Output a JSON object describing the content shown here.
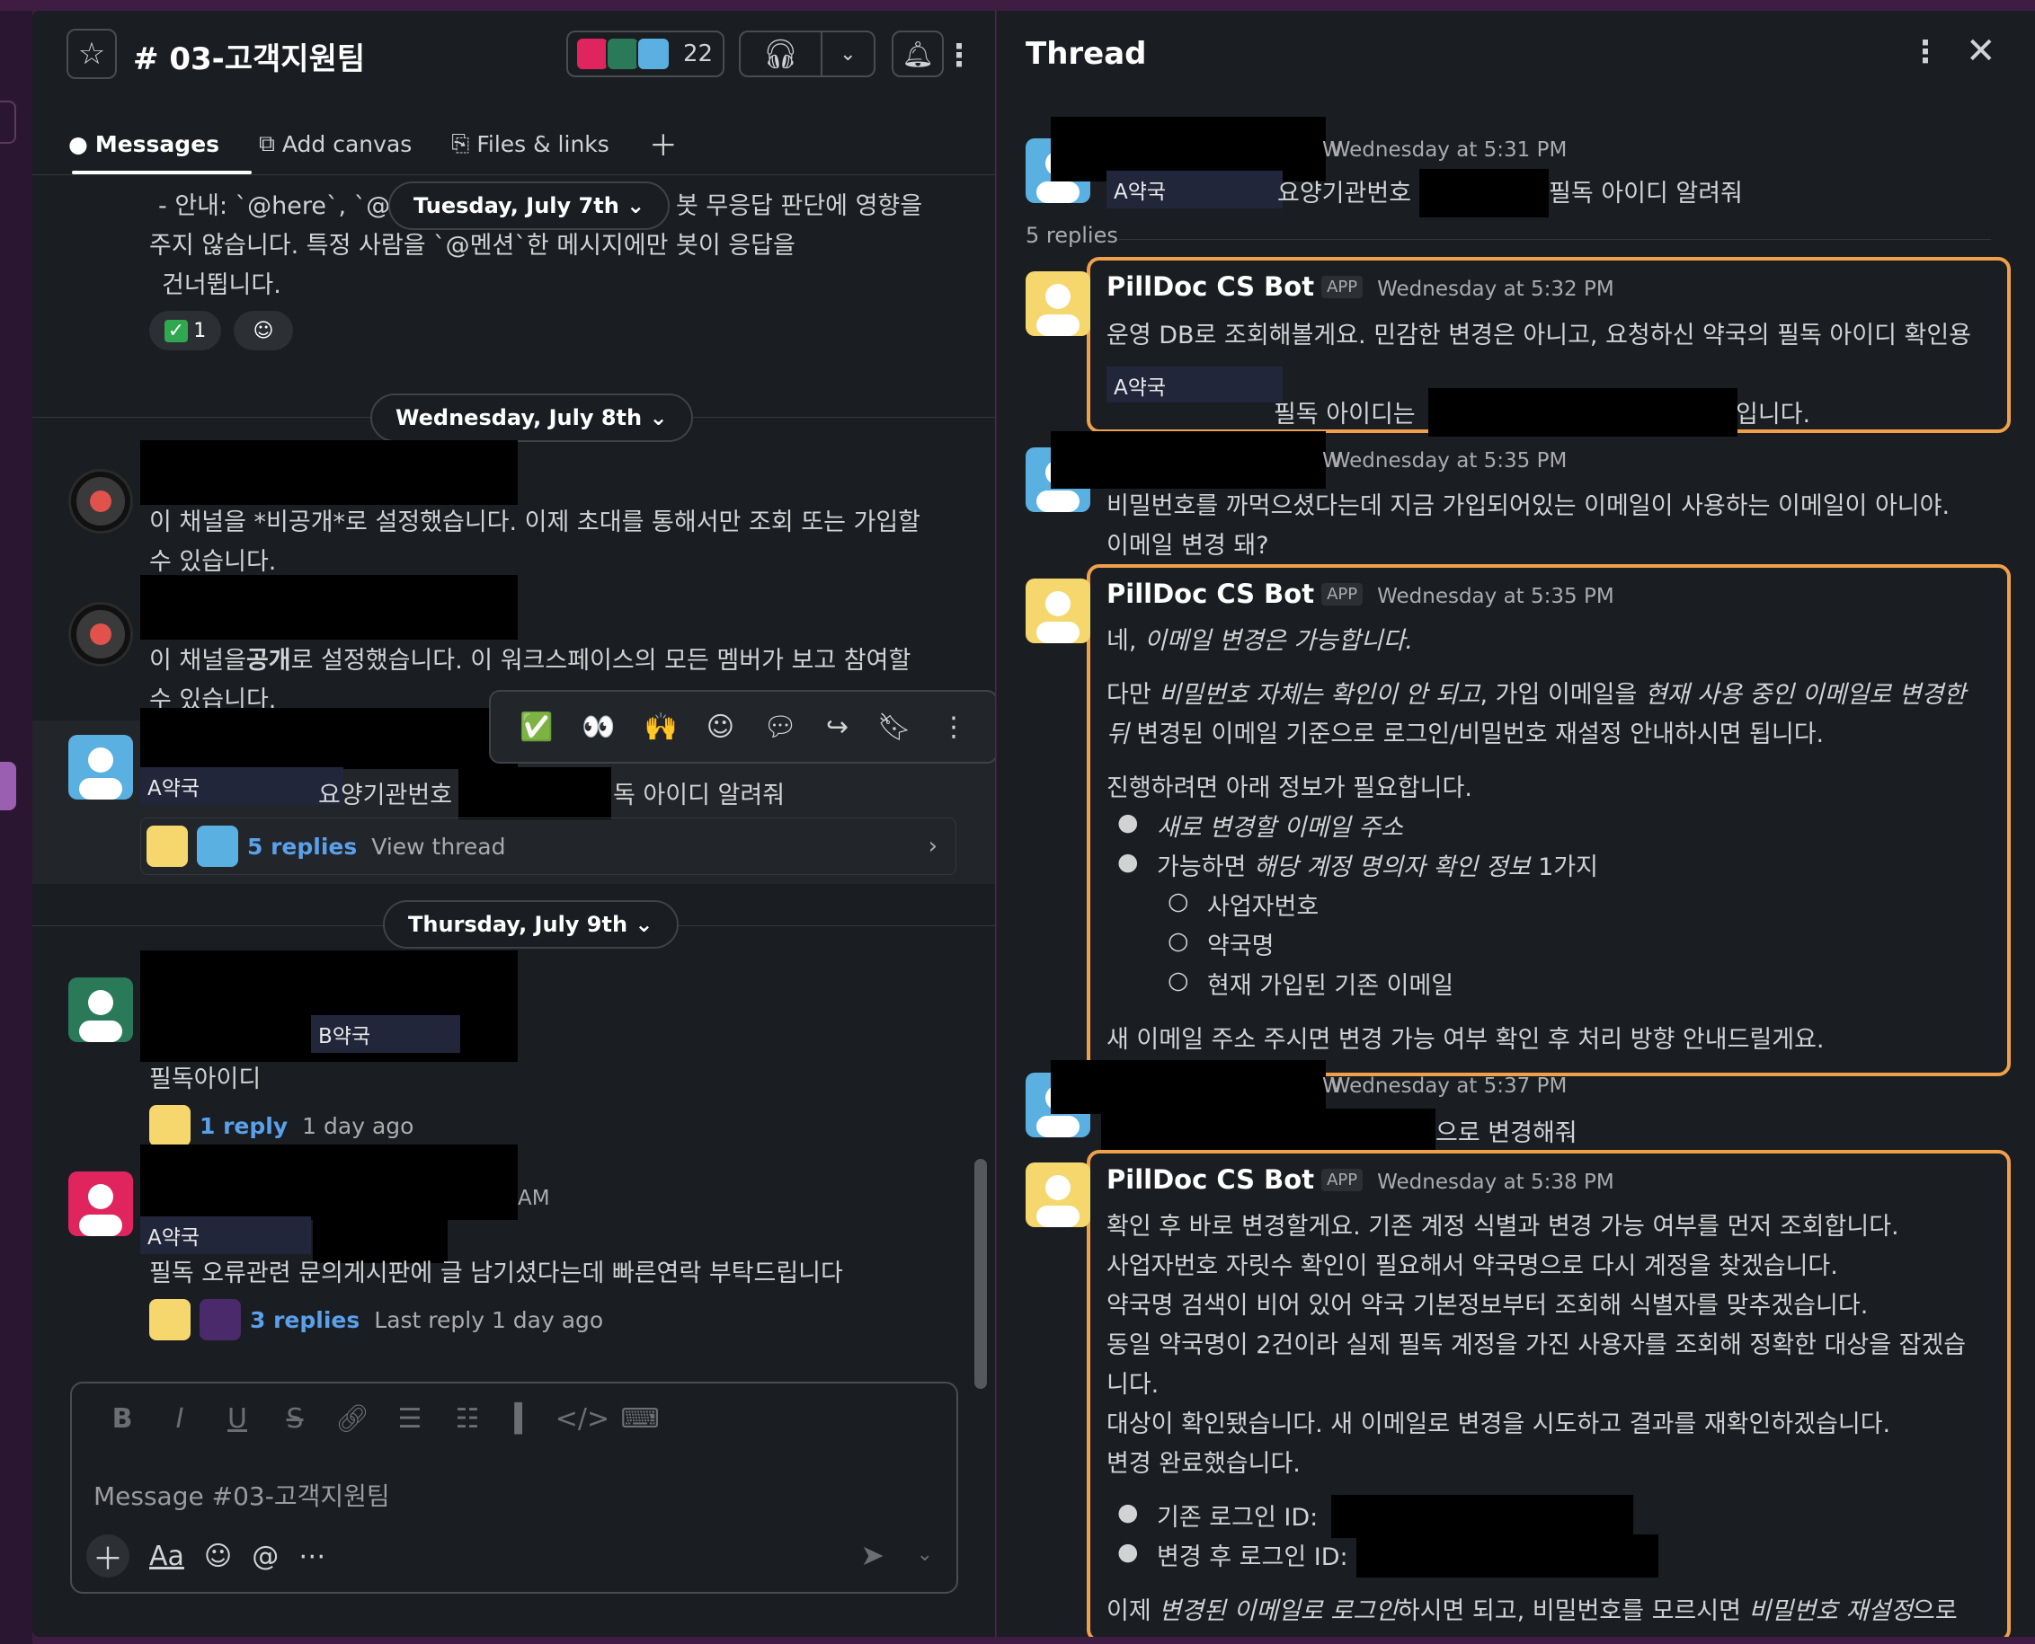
{
  "channel": {
    "name": "# 03-고객지원팀",
    "member_count": "22",
    "tabs": {
      "messages": "Messages",
      "add_canvas": "Add canvas",
      "files_links": "Files & links"
    },
    "top_text": {
      "line1a": "- 안내: `@here`, `@c",
      "line1b": "]은 봇 무응답 판단에 영향을",
      "line2": "주지 않습니다. 특정 사람을 `@멘션`한 메시지에만 봇이 응답을",
      "line3": "건너뜁니다."
    },
    "reaction_count": "1",
    "dates": {
      "d1": "Tuesday, July 7th",
      "d2": "Wednesday, July 8th",
      "d3": "Thursday, July 9th"
    },
    "messages": {
      "private_notice": "이 채널을 *비공개*로 설정했습니다. 이제 초대를 통해서만 조회 또는 가입할",
      "private_notice2": "수 있습니다.",
      "public_notice_a": "이 채널을",
      "public_notice_b": "공개",
      "public_notice_c": "로 설정했습니다. 이 워크스페이스의 모든 멤버가 보고 참여할",
      "public_notice2": "수 있습니다.",
      "a_label": "A약국",
      "q_text_a": "요양기관번호",
      "q_text_b": "독 아이디 알려줘",
      "q_replies": "5 replies",
      "q_view": "View thread",
      "b_label": "B약국",
      "b_text": "필독아이디",
      "b_replies": "1 reply",
      "b_meta": "1 day ago",
      "c_time_fragment": "AM",
      "c_label": "A약국",
      "c_text": "필독 오류관련 문의게시판에 글 남기셨다는데 빠른연락 부탁드립니다",
      "c_replies": "3 replies",
      "c_meta": "Last reply 1 day ago"
    },
    "composer": {
      "placeholder": "Message #03-고객지원팀"
    }
  },
  "thread": {
    "title": "Thread",
    "parent": {
      "time": "Wednesday at 5:31 PM",
      "label": "A약국",
      "text_a": "요양기관번호",
      "text_b": "필독 아이디 알려줘"
    },
    "replies_count": "5 replies",
    "bot_name": "PillDoc CS Bot",
    "app_tag": "APP",
    "r1": {
      "time": "Wednesday at 5:32 PM",
      "line1": "운영 DB로 조회해볼게요. 민감한 변경은 아니고, 요청하신 약국의 필독 아이디 확인용",
      "label": "A약국",
      "line3a": "필독 아이디는",
      "line3b": "입니다."
    },
    "u2": {
      "time": "Wednesday at 5:35 PM",
      "line1": "비밀번호를 까먹으셨다는데 지금 가입되어있는 이메일이 사용하는 이메일이 아니야.",
      "line2": "이메일 변경 돼?"
    },
    "r2": {
      "time": "Wednesday at 5:35 PM",
      "l1a": "네, ",
      "l1b": "이메일 변경은 가능합니다.",
      "l2a": "다만 ",
      "l2b": "비밀번호 자체는 확인이 안 되고",
      "l2c": ", 가입 이메일을 ",
      "l2d": "현재 사용 중인 이메일로 변경한",
      "l3a": "뒤",
      "l3b": " 변경된 이메일 기준으로 로그인/비밀번호 재설정 안내하시면 됩니다.",
      "l4": "진행하려면 아래 정보가 필요합니다.",
      "b1": "새로 변경할 이메일 주소",
      "b2a": "가능하면 ",
      "b2b": "해당 계정 명의자 확인 정보",
      "b2c": " 1가지",
      "s1": "사업자번호",
      "s2": "약국명",
      "s3": "현재 가입된 기존 이메일",
      "l5": "새 이메일 주소 주시면 변경 가능 여부 확인 후 처리 방향 안내드릴게요."
    },
    "u3": {
      "time": "Wednesday at 5:37 PM",
      "text": "으로 변경해줘"
    },
    "r3": {
      "time": "Wednesday at 5:38 PM",
      "l1": "확인 후 바로 변경할게요. 기존 계정 식별과 변경 가능 여부를 먼저 조회합니다.",
      "l2": "사업자번호 자릿수 확인이 필요해서 약국명으로 다시 계정을 찾겠습니다.",
      "l3": "약국명 검색이 비어 있어 약국 기본정보부터 조회해 식별자를 맞추겠습니다.",
      "l4": "동일 약국명이 2건이라 실제 필독 계정을 가진 사용자를 조회해 정확한 대상을 잡겠습",
      "l5": "니다.",
      "l6": "대상이 확인됐습니다. 새 이메일로 변경을 시도하고 결과를 재확인하겠습니다.",
      "l7": "변경 완료했습니다.",
      "b1": "기존 로그인 ID:",
      "b2": "변경 후 로그인 ID:",
      "l8a": "이제 ",
      "l8b": "변경된 이메일로 로그인",
      "l8c": "하시면 되고, 비밀번호를 모르시면 ",
      "l8d": "비밀번호 재설정",
      "l8e": "으로"
    }
  },
  "colors": {
    "highlight": "#f0a04b",
    "link": "#5aa0ea",
    "background": "#1a1d21"
  }
}
